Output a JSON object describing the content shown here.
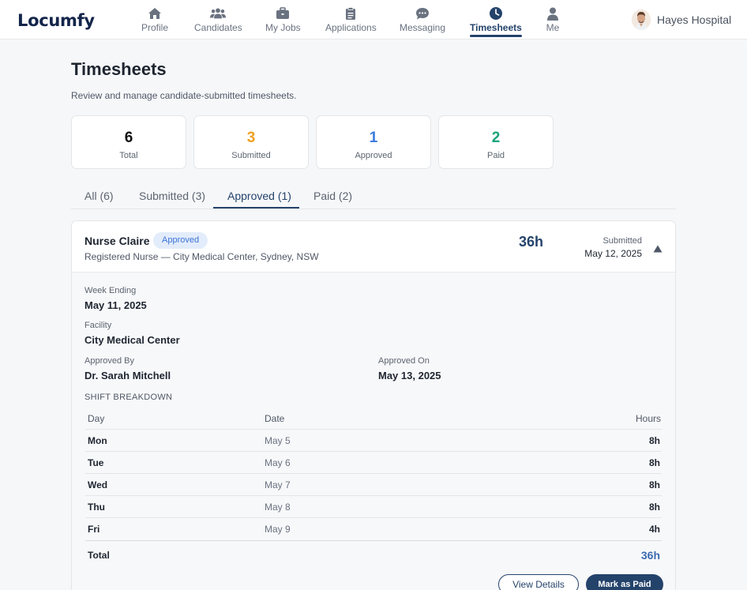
{
  "brand": "Locumfy",
  "nav": {
    "items": [
      {
        "label": "Profile",
        "icon": "home-icon"
      },
      {
        "label": "Candidates",
        "icon": "users-icon"
      },
      {
        "label": "My Jobs",
        "icon": "briefcase-icon"
      },
      {
        "label": "Applications",
        "icon": "clipboard-icon"
      },
      {
        "label": "Messaging",
        "icon": "chat-icon"
      },
      {
        "label": "Timesheets",
        "icon": "clock-icon"
      },
      {
        "label": "Me",
        "icon": "person-icon"
      }
    ],
    "active": "Timesheets"
  },
  "user": {
    "name": "Hayes Hospital"
  },
  "page": {
    "title": "Timesheets",
    "subtitle": "Review and manage candidate-submitted timesheets."
  },
  "stats": [
    {
      "value": "6",
      "label": "Total",
      "color": "#111111"
    },
    {
      "value": "3",
      "label": "Submitted",
      "color": "#f0a020"
    },
    {
      "value": "1",
      "label": "Approved",
      "color": "#3b7be0"
    },
    {
      "value": "2",
      "label": "Paid",
      "color": "#1aa37a"
    }
  ],
  "tabs": [
    {
      "label": "All (6)"
    },
    {
      "label": "Submitted (3)"
    },
    {
      "label": "Approved (1)"
    },
    {
      "label": "Paid (2)"
    }
  ],
  "active_tab": "Approved (1)",
  "timesheet": {
    "candidate": "Nurse Claire",
    "status": "Approved",
    "role": "Registered Nurse — City Medical Center, Sydney, NSW",
    "hours": "36h",
    "submitted_label": "Submitted",
    "submitted_date": "May 12, 2025",
    "week_ending_label": "Week Ending",
    "week_ending": "May 11, 2025",
    "facility_label": "Facility",
    "facility": "City Medical Center",
    "approved_by_label": "Approved By",
    "approved_by": "Dr. Sarah Mitchell",
    "approved_on_label": "Approved On",
    "approved_on": "May 13, 2025",
    "breakdown_title": "SHIFT BREAKDOWN",
    "columns": {
      "day": "Day",
      "date": "Date",
      "hours": "Hours"
    },
    "shifts": [
      {
        "day": "Mon",
        "date": "May 5",
        "hours": "8h"
      },
      {
        "day": "Tue",
        "date": "May 6",
        "hours": "8h"
      },
      {
        "day": "Wed",
        "date": "May 7",
        "hours": "8h"
      },
      {
        "day": "Thu",
        "date": "May 8",
        "hours": "8h"
      },
      {
        "day": "Fri",
        "date": "May 9",
        "hours": "4h"
      }
    ],
    "total_label": "Total",
    "total_hours": "36h",
    "view_details": "View Details",
    "mark_paid": "Mark as Paid"
  }
}
